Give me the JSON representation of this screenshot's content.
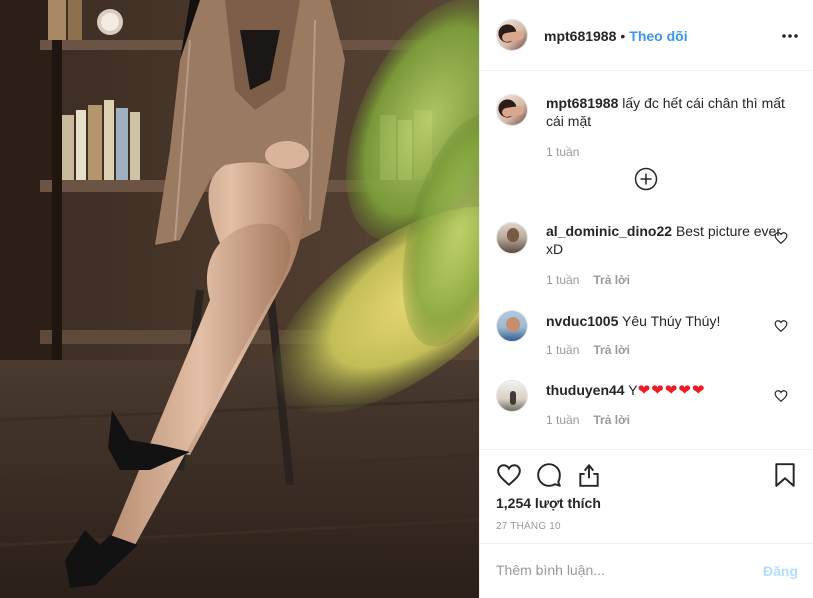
{
  "post": {
    "owner": {
      "username": "mpt681988",
      "follow_label": "Theo dõi",
      "separator": "•"
    },
    "caption": {
      "username": "mpt681988",
      "text": "lấy đc hết cái chân thì mất cái mặt",
      "time": "1 tuần"
    },
    "comments": [
      {
        "username": "al_dominic_dino22",
        "text": "Best picture ever xD",
        "time": "1 tuần",
        "reply_label": "Trả lời"
      },
      {
        "username": "nvduc1005",
        "text": "Yêu Thúy Thúy!",
        "time": "1 tuần",
        "reply_label": "Trả lời"
      },
      {
        "username": "thuduyen44",
        "text": "Y",
        "emoji": "❤❤❤❤❤",
        "time": "1 tuần",
        "reply_label": "Trả lời"
      }
    ],
    "likes_text": "1,254 lượt thích",
    "date_text": "27 THÁNG 10",
    "comment_box": {
      "placeholder": "Thêm bình luận...",
      "post_label": "Đăng"
    }
  },
  "icons": {
    "more": "more-options-icon",
    "load_more": "plus-circle-icon",
    "like": "heart-icon",
    "comment": "comment-icon",
    "share": "share-icon",
    "save": "bookmark-icon"
  },
  "colors": {
    "accent": "#3897f0",
    "muted": "#999999",
    "post_disabled": "#b2dffc",
    "emoji_heart": "#ed1c24"
  }
}
